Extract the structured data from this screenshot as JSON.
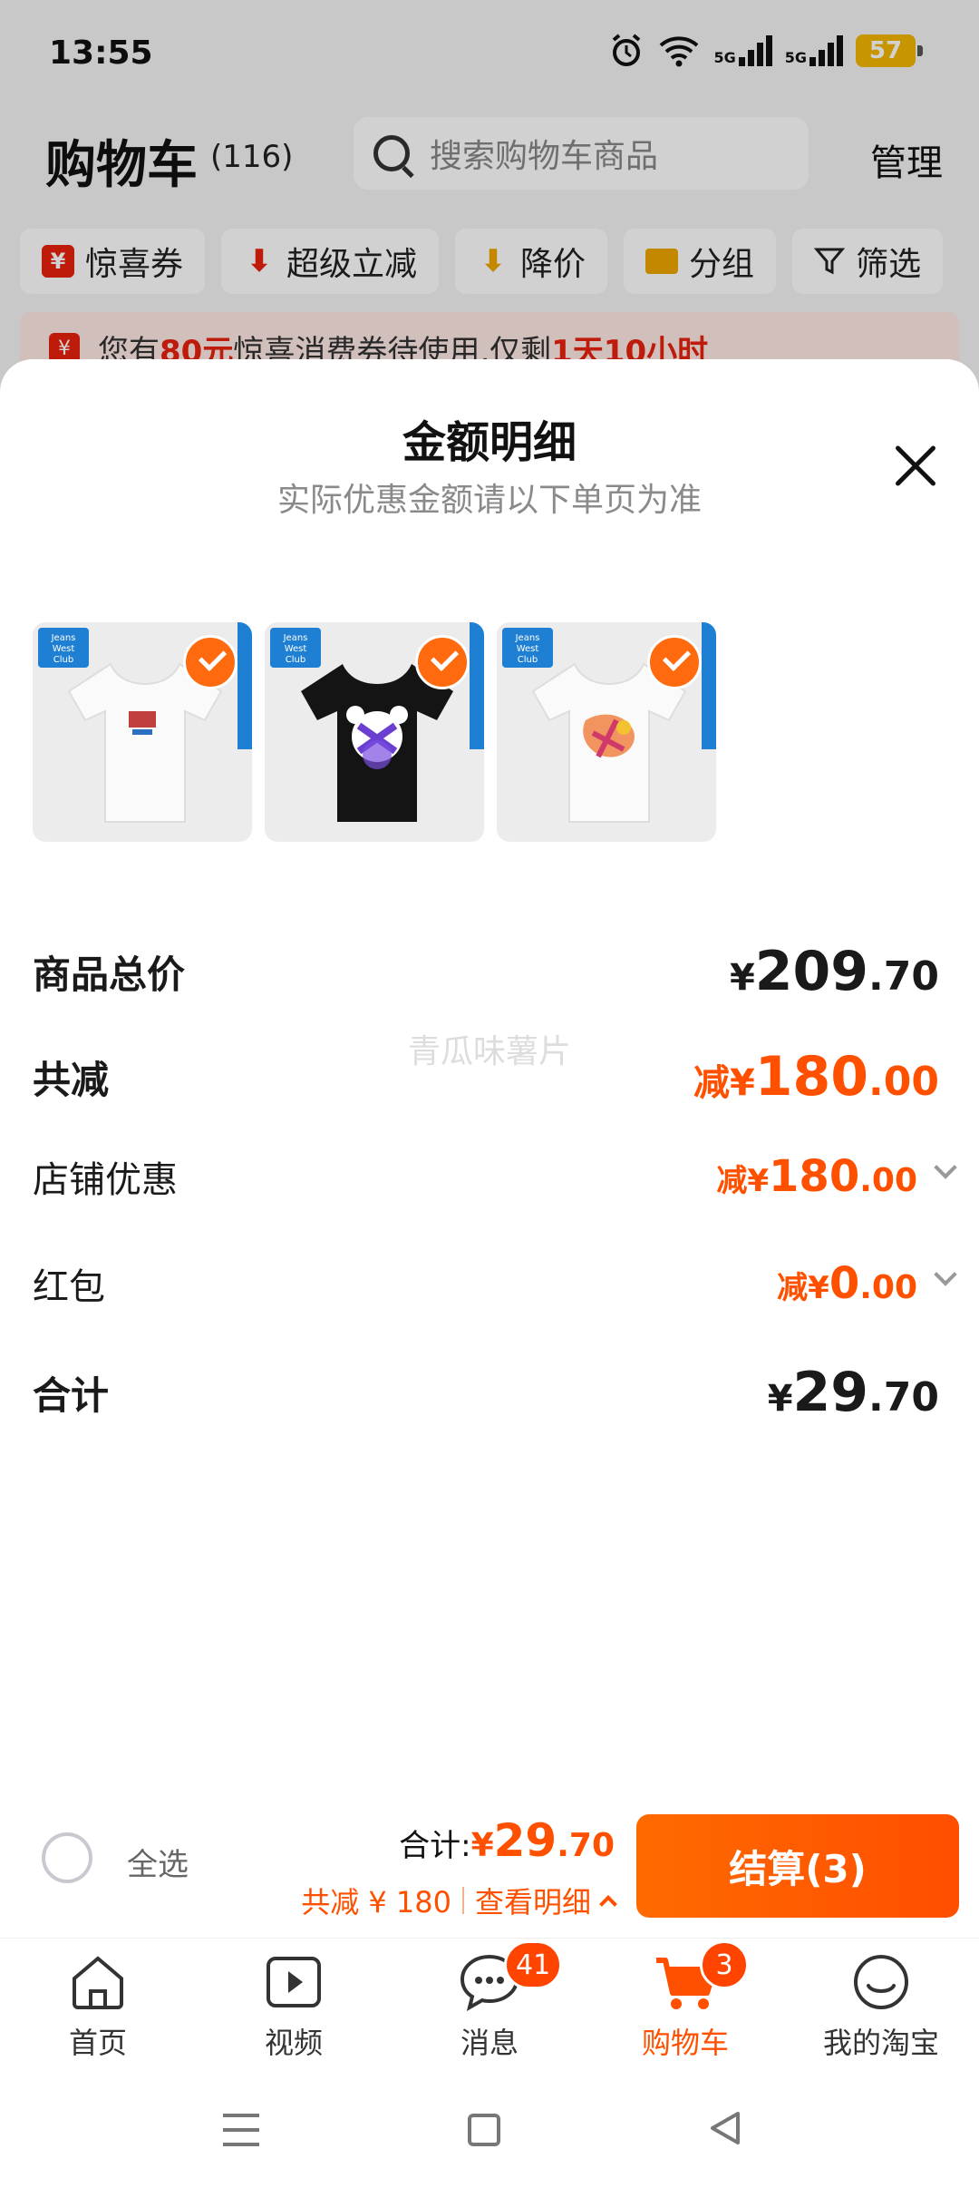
{
  "status_bar": {
    "time": "13:55",
    "network_1": "5G",
    "network_2": "5G",
    "battery": "57"
  },
  "header": {
    "title": "购物车",
    "count": "(116)",
    "search_placeholder": "搜索购物车商品",
    "manage": "管理"
  },
  "filters": [
    {
      "label": "惊喜券",
      "icon": "coupon-icon"
    },
    {
      "label": "超级立减",
      "icon": "down-arrow-icon"
    },
    {
      "label": "降价",
      "icon": "price-drop-icon"
    },
    {
      "label": "分组",
      "icon": "folder-icon"
    },
    {
      "label": "筛选",
      "icon": "filter-icon"
    }
  ],
  "notice": {
    "pre": "您有",
    "amount": "80元",
    "mid": "惊喜消费券待使用,仅剩",
    "time": "1天10小时"
  },
  "sheet": {
    "title": "金额明细",
    "subtitle": "实际优惠金额请以下单页为准",
    "products": [
      {
        "name": "white-tshirt-small-print",
        "selected": true,
        "color": "#f4f4f4"
      },
      {
        "name": "black-tshirt-bear-print",
        "selected": true,
        "color": "#111111"
      },
      {
        "name": "white-tshirt-graffiti-print",
        "selected": true,
        "color": "#f4f4f4"
      }
    ],
    "rows": {
      "subtotal": {
        "label": "商品总价",
        "cur": "¥",
        "int": "209",
        "dec": ".70"
      },
      "total_discount": {
        "label": "共减",
        "pre": "减",
        "cur": "¥",
        "int": "180",
        "dec": ".00"
      },
      "shop_discount": {
        "label": "店铺优惠",
        "pre": "减",
        "cur": "¥",
        "int": "180",
        "dec": ".00"
      },
      "red_packet": {
        "label": "红包",
        "pre": "减",
        "cur": "¥",
        "int": "0",
        "dec": ".00"
      },
      "total": {
        "label": "合计",
        "cur": "¥",
        "int": "29",
        "dec": ".70"
      }
    },
    "watermark": "青瓜味薯片"
  },
  "checkout": {
    "select_all": "全选",
    "total_label": "合计:",
    "total_cur": "¥",
    "total_int": "29",
    "total_dec": ".70",
    "saving": "共减 ¥ 180",
    "detail": "查看明细",
    "button": "结算(3)"
  },
  "tabs": [
    {
      "label": "首页",
      "icon": "home-icon",
      "badge": ""
    },
    {
      "label": "视频",
      "icon": "video-icon",
      "badge": ""
    },
    {
      "label": "消息",
      "icon": "message-icon",
      "badge": "41"
    },
    {
      "label": "购物车",
      "icon": "cart-icon",
      "badge": "3",
      "active": true
    },
    {
      "label": "我的淘宝",
      "icon": "profile-icon",
      "badge": ""
    }
  ],
  "colors": {
    "accent": "#ff5000",
    "notice_red": "#e8220e",
    "check": "#ff6a0f"
  }
}
